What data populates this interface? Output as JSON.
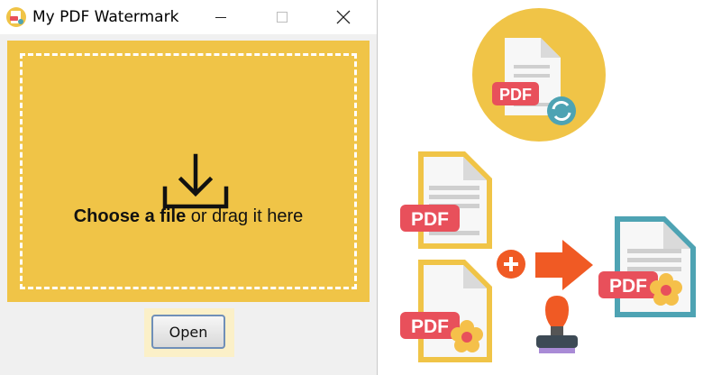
{
  "window": {
    "title": "My PDF Watermark",
    "minimize_icon": "minimize-icon",
    "maximize_icon": "maximize-icon",
    "close_icon": "close-icon",
    "app_icon": "pdf-watermark-app-icon"
  },
  "dropzone": {
    "icon": "download-icon",
    "choose_strong": "Choose a file",
    "choose_rest": " or drag it here",
    "background_color": "#f0c447"
  },
  "open_button": {
    "label": "Open"
  },
  "illustration": {
    "pdf_label": "PDF",
    "icons": [
      "pdf-convert-icon",
      "pdf-document-icon",
      "plus-icon",
      "arrow-right-icon",
      "stamp-icon",
      "flower-watermark-icon"
    ],
    "colors": {
      "yellow": "#f0c447",
      "pdf_red": "#e8505b",
      "teal": "#4ea3b3",
      "orange": "#f05a24",
      "flower": "#f5c04a"
    }
  }
}
